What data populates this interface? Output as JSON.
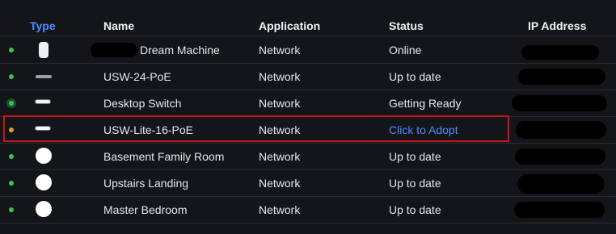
{
  "columns": {
    "type": "Type",
    "name": "Name",
    "application": "Network",
    "application_header": "Application",
    "status": "Status",
    "ip": "IP Address"
  },
  "rows": [
    {
      "name": "Dream Machine",
      "application": "Network",
      "status": "Online",
      "status_dot": "green",
      "device_icon": "dream-machine-icon"
    },
    {
      "name": "USW-24-PoE",
      "application": "Network",
      "status": "Up to date",
      "status_dot": "green",
      "device_icon": "rack-switch-icon"
    },
    {
      "name": "Desktop Switch",
      "application": "Network",
      "status": "Getting Ready",
      "status_dot": "green-ring",
      "device_icon": "desktop-switch-icon"
    },
    {
      "name": "USW-Lite-16-PoE",
      "application": "Network",
      "status": "Click to Adopt",
      "status_dot": "orange",
      "device_icon": "desktop-switch-icon"
    },
    {
      "name": "Basement Family Room",
      "application": "Network",
      "status": "Up to date",
      "status_dot": "green",
      "device_icon": "access-point-icon"
    },
    {
      "name": "Upstairs Landing",
      "application": "Network",
      "status": "Up to date",
      "status_dot": "green",
      "device_icon": "access-point-icon"
    },
    {
      "name": "Master Bedroom",
      "application": "Network",
      "status": "Up to date",
      "status_dot": "green",
      "device_icon": "access-point-icon"
    }
  ],
  "colors": {
    "background": "#141519",
    "accent": "#4c8dff",
    "online": "#38c25a",
    "pending": "#e89a2b",
    "highlight": "#c8161d"
  }
}
